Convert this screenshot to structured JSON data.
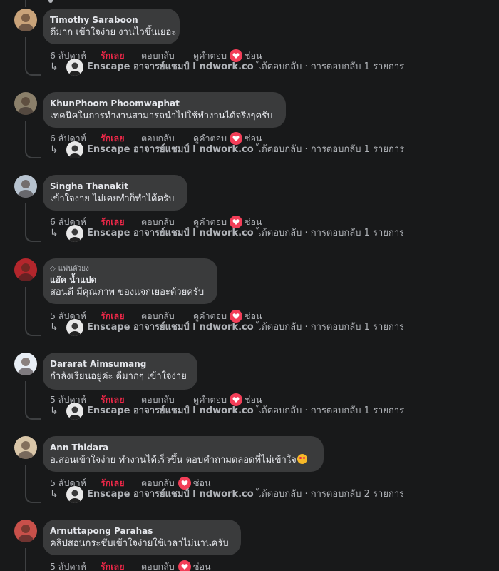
{
  "actions": {
    "like": "รักเลย",
    "reply": "ตอบกลับ",
    "see_reply": "ดูคำตอบ",
    "hide": "ซ่อน"
  },
  "reply_summary": {
    "page_name": "Enscape อาจารย์แชมป์ I ndwork.co",
    "verb": " ได้ตอบกลับ · การตอบกลับ ",
    "suffix": " รายการ"
  },
  "comments": [
    {
      "author": "Timothy Saraboon",
      "badge": "",
      "text": "ดีมาก เข้าใจง่าย งานไวขึ้นเยอะ",
      "time": "6 สัปดาห์",
      "has_see_reply": true,
      "reaction": "heart",
      "reply_count": "1",
      "avatar_color": "#c9a37a"
    },
    {
      "author": "KhunPhoom Phoomwaphat",
      "badge": "",
      "text": "เทคนิคในการทำงานสามารถนำไปใช้ทำงานได้จริงๆครับ",
      "time": "6 สัปดาห์",
      "has_see_reply": true,
      "reaction": "heart",
      "reply_count": "1",
      "avatar_color": "#8a7f6a"
    },
    {
      "author": "Singha Thanakit",
      "badge": "",
      "text": "เข้าใจง่าย ไม่เคยทำก็ทำได้ครับ",
      "time": "6 สัปดาห์",
      "has_see_reply": true,
      "reaction": "heart",
      "reply_count": "1",
      "avatar_color": "#b7c3cf"
    },
    {
      "author": "แอ๊ค น้ำแปด",
      "badge": "แฟนตัวยง",
      "text": "สอนดี มีคุณภาพ ของแจกเยอะด้วยครับ",
      "time": "5 สัปดาห์",
      "has_see_reply": true,
      "reaction": "heart",
      "reply_count": "1",
      "avatar_color": "#b3262c"
    },
    {
      "author": "Dararat Aimsumang",
      "badge": "",
      "text": "กำลังเรียนอยู่ค่ะ ดีมากๆ เข้าใจง่าย",
      "time": "5 สัปดาห์",
      "has_see_reply": true,
      "reaction": "heart",
      "reply_count": "1",
      "avatar_color": "#e8eef5"
    },
    {
      "author": "Ann Thidara",
      "badge": "",
      "text": "อ.สอนเข้าใจง่าย ทำงานได้เร็วขึ้น ตอบคำถามตลอดที่ไม่เข้าใจ",
      "emoji": "smiling-face-with-hearts",
      "time": "5 สัปดาห์",
      "has_see_reply": false,
      "reaction": "heart",
      "reply_count": "2",
      "avatar_color": "#d9c6a8"
    },
    {
      "author": "Arnuttapong Parahas",
      "badge": "",
      "text": "คลิปสอนกระชับเข้าใจง่ายใช้เวลาไม่นานครับ",
      "time": "5 สัปดาห์",
      "has_see_reply": false,
      "reaction": "heart",
      "reply_count": "",
      "avatar_color": "#c8504a"
    }
  ],
  "colors": {
    "background": "#18191a",
    "bubble": "#3a3b3c",
    "like_red": "#f02849",
    "heart_red": "#f33e58",
    "muted_text": "#b0b3b8",
    "primary_text": "#e4e6eb"
  }
}
